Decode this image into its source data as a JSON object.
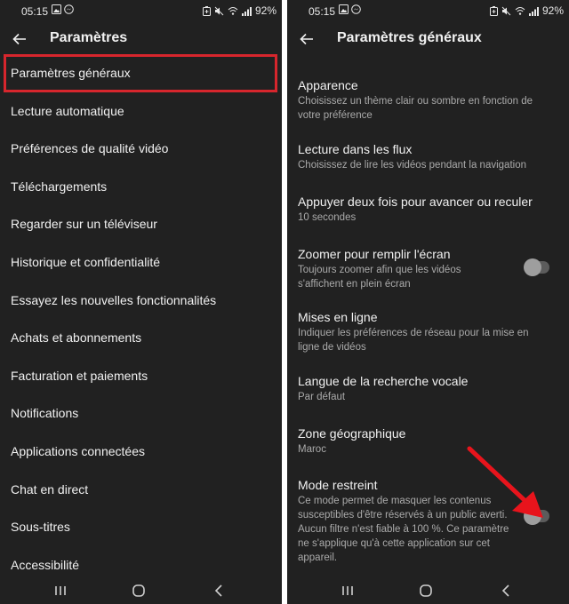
{
  "status_bar": {
    "time": "05:15",
    "battery": "92%"
  },
  "left_screen": {
    "title": "Paramètres",
    "items": [
      {
        "label": "Paramètres généraux"
      },
      {
        "label": "Lecture automatique"
      },
      {
        "label": "Préférences de qualité vidéo"
      },
      {
        "label": "Téléchargements"
      },
      {
        "label": "Regarder sur un téléviseur"
      },
      {
        "label": "Historique et confidentialité"
      },
      {
        "label": "Essayez les nouvelles fonctionnalités"
      },
      {
        "label": "Achats et abonnements"
      },
      {
        "label": "Facturation et paiements"
      },
      {
        "label": "Notifications"
      },
      {
        "label": "Applications connectées"
      },
      {
        "label": "Chat en direct"
      },
      {
        "label": "Sous-titres"
      },
      {
        "label": "Accessibilité"
      }
    ]
  },
  "right_screen": {
    "title": "Paramètres généraux",
    "settings": [
      {
        "title": "Apparence",
        "desc_lines": [
          "Choisissez un thème clair ou sombre en fonction de",
          "votre préférence"
        ]
      },
      {
        "title": "Lecture dans les flux",
        "desc_lines": [
          "Choisissez de lire les vidéos pendant la navigation"
        ]
      },
      {
        "title": "Appuyer deux fois pour avancer ou reculer",
        "desc_lines": [
          "10 secondes"
        ]
      },
      {
        "title": "Zoomer pour remplir l'écran",
        "desc_lines": [
          "Toujours zoomer afin que les vidéos",
          "s'affichent en plein écran"
        ],
        "toggle_on": false
      },
      {
        "title": "Mises en ligne",
        "desc_lines": [
          "Indiquer les préférences de réseau pour la mise en",
          "ligne de vidéos"
        ]
      },
      {
        "title": "Langue de la recherche vocale",
        "desc_lines": [
          "Par défaut"
        ]
      },
      {
        "title": "Zone géographique",
        "desc_lines": [
          "Maroc"
        ]
      },
      {
        "title": "Mode restreint",
        "desc_lines": [
          "Ce mode permet de masquer les contenus",
          "susceptibles d'être réservés à un public averti.",
          "Aucun filtre n'est fiable à 100 %. Ce paramètre",
          "ne s'applique qu'à cette application sur cet",
          "appareil."
        ],
        "toggle_on": false
      }
    ]
  },
  "colors": {
    "background": "#212121",
    "text_primary": "#f1f1f1",
    "text_secondary": "#aaaaaa",
    "highlight": "#d7262d",
    "arrow": "#e8141c",
    "toggle_off_track": "#5c5c5c",
    "toggle_off_knob": "#9e9e9e"
  },
  "icons": {
    "back": "arrow-left-icon",
    "status_left": [
      "image-icon",
      "messenger-icon"
    ],
    "status_right": [
      "battery-saver-icon",
      "mute-icon",
      "wifi-icon",
      "signal-icon"
    ],
    "nav": [
      "recent-apps-icon",
      "home-icon",
      "back-chevron-icon"
    ]
  }
}
